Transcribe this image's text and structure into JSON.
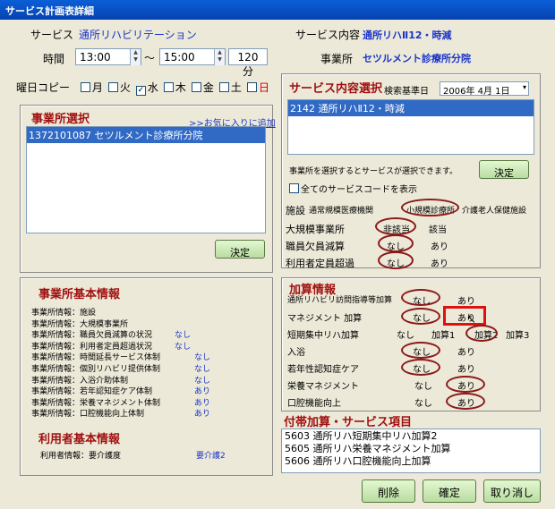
{
  "window": {
    "title": "サービス計画表詳細"
  },
  "header": {
    "service_label": "サービス",
    "service_value": "通所リハビリテーション",
    "time_label": "時間",
    "start_time": "13:00",
    "tilde": "〜",
    "end_time": "15:00",
    "duration": "120分",
    "content_label": "サービス内容",
    "content_value": "通所リハⅡ12・時減",
    "office_label": "事業所",
    "office_value": "セツルメント診療所分院"
  },
  "weekday": {
    "label": "曜日コピー",
    "days": [
      {
        "name": "月",
        "checked": false
      },
      {
        "name": "火",
        "checked": false
      },
      {
        "name": "水",
        "checked": true
      },
      {
        "name": "木",
        "checked": false
      },
      {
        "name": "金",
        "checked": false
      },
      {
        "name": "土",
        "checked": false
      },
      {
        "name": "日",
        "checked": false
      }
    ]
  },
  "office_select": {
    "title": "事業所選択",
    "fav_link": ">>お気に入りに追加",
    "item": "1372101087 セツルメント診療所分院",
    "decide": "決定"
  },
  "service_select": {
    "title": "サービス内容選択",
    "date_label": "検索基準日",
    "date_value": "2006年 4月 1日",
    "item": "2142 通所リハⅡ12・時減",
    "note": "事業所を選択するとサービスが選択できます。",
    "decide": "決定",
    "show_all": "全てのサービスコードを表示",
    "facility_label": "施設",
    "facility_opts": [
      "通常規模医療機関",
      "小規模診療所",
      "介護老人保健施設"
    ],
    "rows": [
      {
        "label": "大規模事業所",
        "opt1": "非該当",
        "opt2": "該当"
      },
      {
        "label": "職員欠員減算",
        "opt1": "なし",
        "opt2": "あり"
      },
      {
        "label": "利用者定員超過",
        "opt1": "なし",
        "opt2": "あり"
      }
    ]
  },
  "office_info": {
    "title": "事業所基本情報",
    "lines": [
      {
        "label": "事業所情報：施設",
        "value": ""
      },
      {
        "label": "事業所情報：大規模事業所",
        "value": ""
      },
      {
        "label": "事業所情報：職員欠員減算の状況",
        "value": "なし"
      },
      {
        "label": "事業所情報：利用者定員超過状況",
        "value": "なし"
      },
      {
        "label": "事業所情報：時間延長サービス体制",
        "value": "なし"
      },
      {
        "label": "事業所情報：個別リハビリ提供体制",
        "value": "なし"
      },
      {
        "label": "事業所情報：入浴介助体制",
        "value": "なし"
      },
      {
        "label": "事業所情報：若年認知症ケア体制",
        "value": "あり"
      },
      {
        "label": "事業所情報：栄養マネジメント体制",
        "value": "あり"
      },
      {
        "label": "事業所情報：口腔機能向上体制",
        "value": "あり"
      }
    ],
    "user_title": "利用者基本情報",
    "user_label": "利用者情報：要介護度",
    "user_value": "要介護2"
  },
  "addition": {
    "title": "加算情報",
    "rows": [
      {
        "label": "通所リハビリ訪問指導等加算",
        "opts": [
          "なし",
          "あり"
        ]
      },
      {
        "label": "マネジメント 加算",
        "opts": [
          "なし",
          "あり"
        ]
      },
      {
        "label": "短期集中リハ加算",
        "opts": [
          "なし",
          "加算1",
          "加算2",
          "加算3"
        ]
      },
      {
        "label": "入浴",
        "opts": [
          "なし",
          "あり"
        ]
      },
      {
        "label": "若年性認知症ケア",
        "opts": [
          "なし",
          "あり"
        ]
      },
      {
        "label": "栄養マネジメント",
        "opts": [
          "なし",
          "あり"
        ]
      },
      {
        "label": "口腔機能向上",
        "opts": [
          "なし",
          "あり"
        ]
      }
    ]
  },
  "extras": {
    "title": "付帯加算・サービス項目",
    "items": [
      "5603 通所リハ短期集中リハ加算2",
      "5605 通所リハ栄養マネジメント加算",
      "5606 通所リハ口腔機能向上加算"
    ]
  },
  "buttons": {
    "delete": "削除",
    "confirm": "確定",
    "cancel": "取り消し"
  },
  "colors": {
    "panel_title": "#a01010",
    "value_blue": "#1a35c8",
    "highlight": "#e01010"
  }
}
